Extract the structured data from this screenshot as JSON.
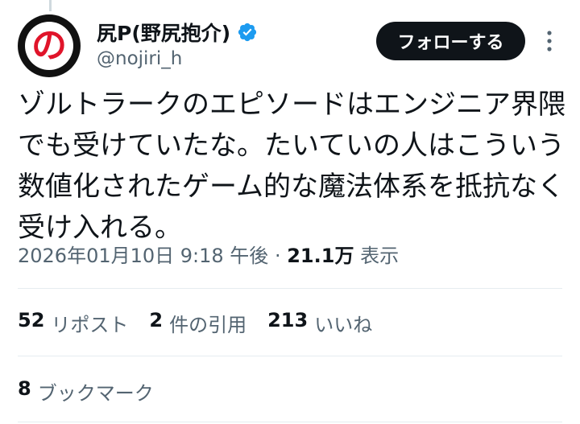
{
  "author": {
    "display_name": "尻P(野尻抱介)",
    "handle": "@nojiri_h",
    "avatar_glyph": "の",
    "verified_icon": "verified-badge-icon",
    "verified_color": "#1d9bf0"
  },
  "actions": {
    "follow_label": "フォローする",
    "more_icon": "more-vertical-icon"
  },
  "tweet": {
    "text": "ゾルトラークのエピソードはエンジニア界隈でも受けていたな。たいていの人はこういう数値化されたゲーム的な魔法体系を抵抗なく受け入れる。",
    "timestamp": "2026年01月10日 9:18 午後",
    "separator": "·",
    "views_count": "21.1万",
    "views_label": "表示"
  },
  "stats": [
    {
      "num": "52",
      "label": "リポスト"
    },
    {
      "num": "2",
      "label": "件の引用"
    },
    {
      "num": "213",
      "label": "いいね"
    }
  ],
  "bookmarks": {
    "num": "8",
    "label": "ブックマーク"
  },
  "colors": {
    "text": "#0f1419",
    "secondary": "#536471",
    "divider": "#e6ecf0",
    "follow_bg": "#0f1419",
    "avatar_accent": "#e0142a"
  }
}
